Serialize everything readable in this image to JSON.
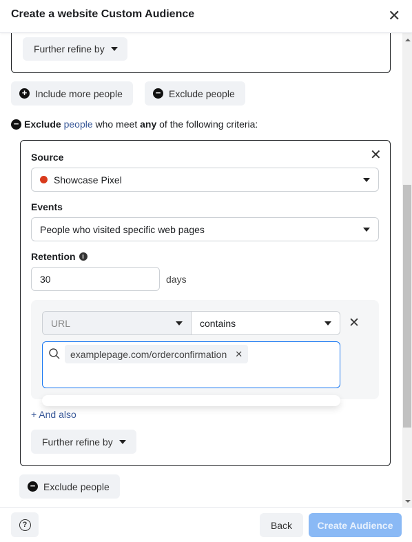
{
  "dialog": {
    "title": "Create a website Custom Audience"
  },
  "top_card": {
    "further_refine": "Further refine by"
  },
  "actions": {
    "include_more": "Include more people",
    "exclude": "Exclude people"
  },
  "criteria": {
    "prefix": "Exclude",
    "link": "people",
    "mid": "who meet",
    "bold": "any",
    "suffix": "of the following criteria:"
  },
  "rule": {
    "source_label": "Source",
    "source_value": "Showcase Pixel",
    "source_color": "#d93a1c",
    "events_label": "Events",
    "events_value": "People who visited specific web pages",
    "retention_label": "Retention",
    "retention_value": "30",
    "retention_unit": "days",
    "url_field": "URL",
    "operator": "contains",
    "tag": "examplepage.com/orderconfirmation",
    "and_also": "+ And also",
    "further_refine": "Further refine by"
  },
  "exclude_people": "Exclude people",
  "footer": {
    "help": "?",
    "back": "Back",
    "create": "Create Audience",
    "create_color": "#8ab9f5"
  }
}
